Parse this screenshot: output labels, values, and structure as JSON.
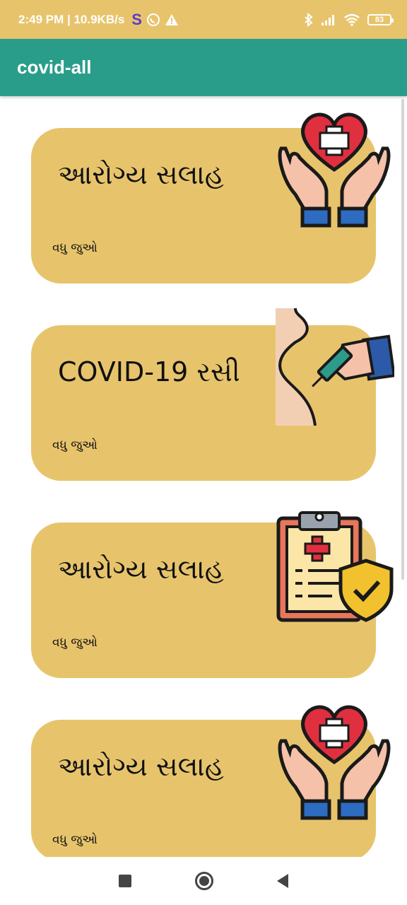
{
  "status_bar": {
    "time_speed": "2:49 PM | 10.9KB/s",
    "s_icon": "S",
    "battery": "83"
  },
  "app": {
    "title": "covid-all"
  },
  "cards": [
    {
      "title": "આરોગ્ય સલાહ",
      "link": "વધુ જુઓ",
      "icon": "heart-hands-icon"
    },
    {
      "title": "COVID-19 રસી",
      "link": "વધુ જુઓ",
      "icon": "vaccine-syringe-icon"
    },
    {
      "title": "આરોગ્ય સલાહ",
      "link": "વધુ જુઓ",
      "icon": "medical-clipboard-shield-icon"
    },
    {
      "title": "આરોગ્ય સલાહ",
      "link": "વધુ જુઓ",
      "icon": "heart-hands-icon"
    }
  ],
  "colors": {
    "status_bar": "#e7c46c",
    "app_bar": "#2a9d8a",
    "card": "#e7c46c"
  }
}
